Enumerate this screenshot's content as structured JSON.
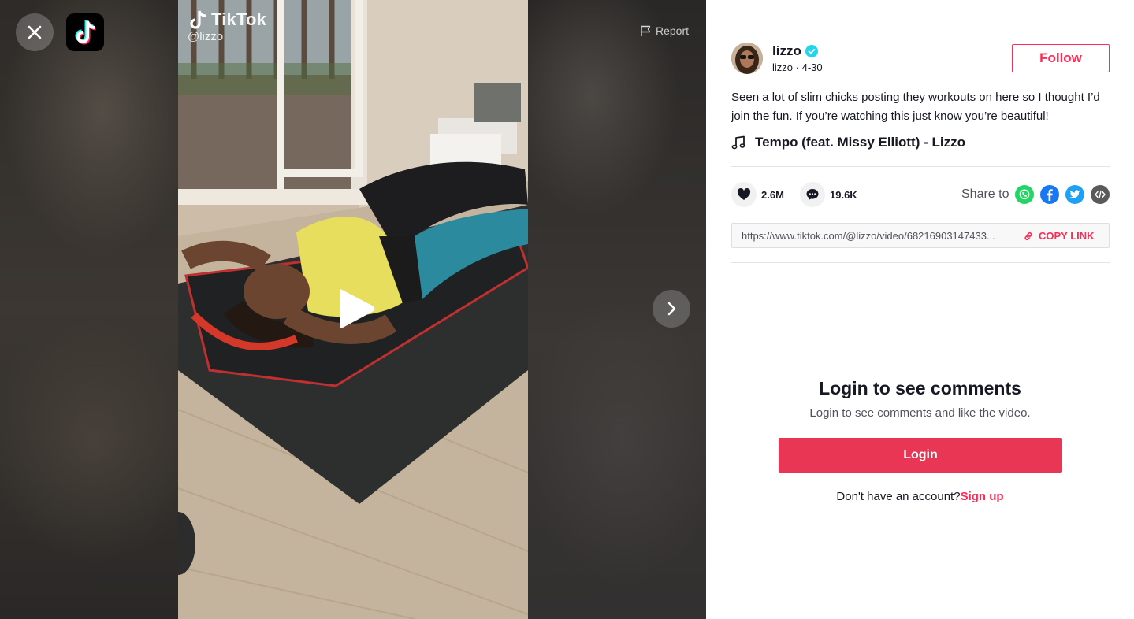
{
  "video": {
    "watermark_brand": "TikTok",
    "watermark_handle": "@lizzo",
    "report_label": "Report"
  },
  "author": {
    "name": "lizzo",
    "username": "lizzo",
    "date": "4-30",
    "verified": true,
    "follow_label": "Follow"
  },
  "caption": "Seen a lot of slim chicks posting they workouts on here so I thought I’d join the fun. If you’re watching this just know you’re beautiful!",
  "music": {
    "title": "Tempo (feat. Missy Elliott) - Lizzo",
    "icon": "music-note-icon"
  },
  "stats": {
    "likes": "2.6M",
    "comments": "19.6K"
  },
  "share": {
    "label": "Share to",
    "targets": [
      {
        "name": "whatsapp",
        "color": "#25d366"
      },
      {
        "name": "facebook",
        "color": "#1877f2"
      },
      {
        "name": "twitter",
        "color": "#1da1f2"
      },
      {
        "name": "embed",
        "color": "#5a5a5a"
      }
    ]
  },
  "link": {
    "url": "https://www.tiktok.com/@lizzo/video/68216903147433...",
    "copy_label": "COPY LINK"
  },
  "comments_gate": {
    "title": "Login to see comments",
    "subtitle": "Login to see comments and like the video.",
    "login_label": "Login",
    "no_account_text": "Don't have an account?",
    "signup_label": "Sign up"
  },
  "colors": {
    "accent": "#fe2c55",
    "login_button": "#ea3655",
    "text_primary": "#161823"
  }
}
